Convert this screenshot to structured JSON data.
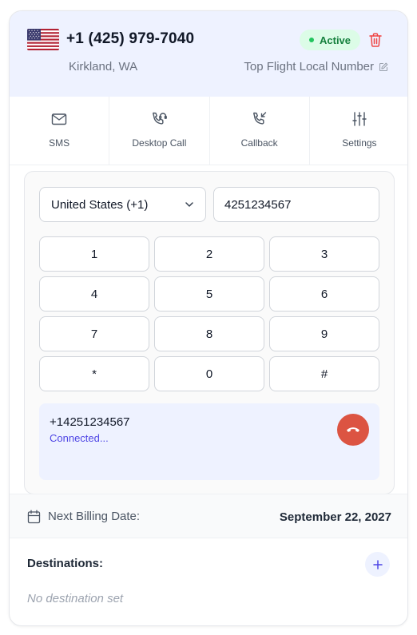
{
  "header": {
    "phone_number": "+1 (425) 979-7040",
    "status": "Active",
    "location": "Kirkland, WA",
    "number_name": "Top Flight Local Number",
    "flag_icon": "us-flag-icon"
  },
  "actions": [
    {
      "label": "SMS",
      "icon": "envelope-icon"
    },
    {
      "label": "Desktop Call",
      "icon": "headset-phone-icon"
    },
    {
      "label": "Callback",
      "icon": "incoming-call-icon"
    },
    {
      "label": "Settings",
      "icon": "sliders-icon"
    }
  ],
  "dialer": {
    "country_selected": "United States (+1)",
    "number_value": "4251234567",
    "keys": [
      "1",
      "2",
      "3",
      "4",
      "5",
      "6",
      "7",
      "8",
      "9",
      "*",
      "0",
      "#"
    ],
    "active_call": {
      "number": "+14251234567",
      "status": "Connected..."
    }
  },
  "billing": {
    "label": "Next Billing Date:",
    "date": "September 22, 2027"
  },
  "destinations": {
    "title": "Destinations:",
    "empty_text": "No destination set"
  },
  "colors": {
    "accent": "#4f46e5",
    "header_bg": "#eef2ff",
    "active_green": "#15803d",
    "hangup_red": "#dc5442",
    "trash_red": "#ef4444"
  }
}
